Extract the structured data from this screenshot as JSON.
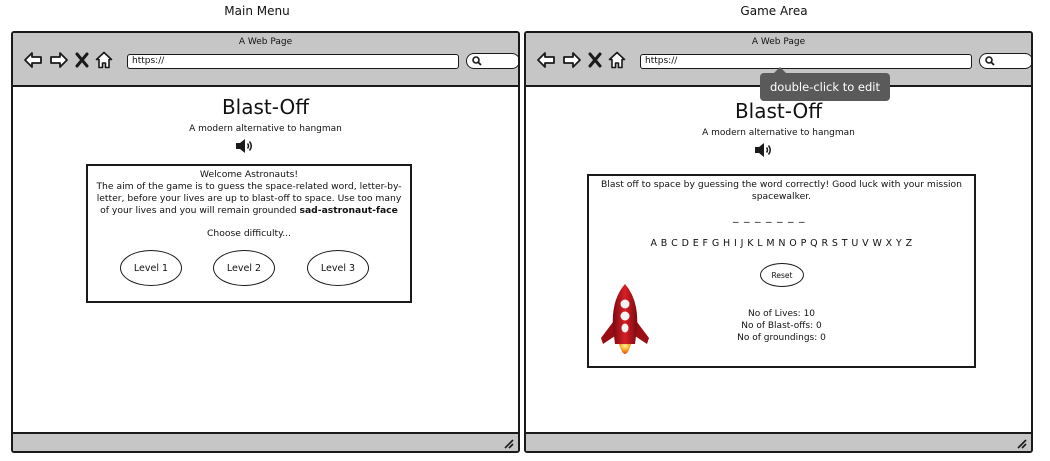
{
  "panels": [
    {
      "caption": "Main Menu",
      "window_title": "A Web Page",
      "url": "https://",
      "game": {
        "title": "Blast-Off",
        "tagline": "A modern alternative to hangman",
        "welcome": "Welcome Astronauts!",
        "intro": "The aim of the game is to guess the space-related word, letter-by-letter, before your lives are up to blast-off to space. Use too many of your lives and you will remain grounded",
        "intro_icon": "sad-astronaut-face",
        "choose": "Choose difficulty...",
        "levels": [
          "Level 1",
          "Level 2",
          "Level 3"
        ]
      }
    },
    {
      "caption": "Game Area",
      "window_title": "A Web Page",
      "url": "https://",
      "tooltip": "double-click to edit",
      "game": {
        "title": "Blast-Off",
        "tagline": "A modern alternative to hangman",
        "instructions": "Blast off to space by guessing the word correctly! Good luck with your mission spacewalker.",
        "word_blanks": "_ _ _ _ _ _ _",
        "alphabet": "A B C D E F G H I J K L M N O P Q R S T U V W X Y Z",
        "reset": "Reset",
        "lives": "No of Lives: 10",
        "blastoffs": "No of Blast-offs: 0",
        "groundings": "No of groundings: 0"
      }
    }
  ],
  "icons": [
    "back-arrow-icon",
    "forward-arrow-icon",
    "close-icon",
    "home-icon",
    "search-icon",
    "speaker-icon",
    "rocket-icon",
    "resize-grip-icon"
  ],
  "colors": {
    "chrome": "#c6c6c6",
    "border": "#1a1a1a",
    "tooltip": "#5a5a5a",
    "rocket_red": "#c0121a",
    "flame": "#f5a623"
  }
}
